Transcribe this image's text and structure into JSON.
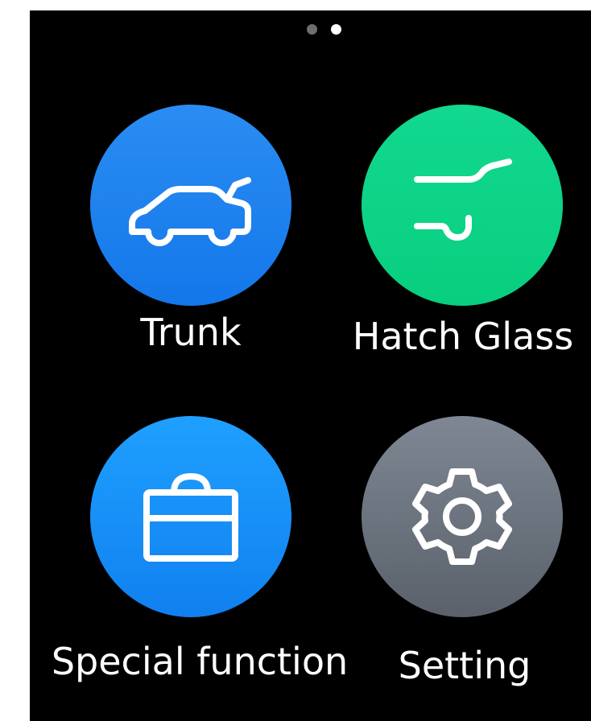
{
  "pager": {
    "pages": 2,
    "current": 2
  },
  "tiles": [
    {
      "label": "Trunk",
      "icon": "car-trunk-icon",
      "color": "#1e82ee"
    },
    {
      "label": "Hatch Glass",
      "icon": "hatch-glass-icon",
      "color": "#0ed486"
    },
    {
      "label": "Special function",
      "icon": "briefcase-icon",
      "color": "#1890f6"
    },
    {
      "label": "Setting",
      "icon": "gear-icon",
      "color": "#6d7580"
    }
  ]
}
